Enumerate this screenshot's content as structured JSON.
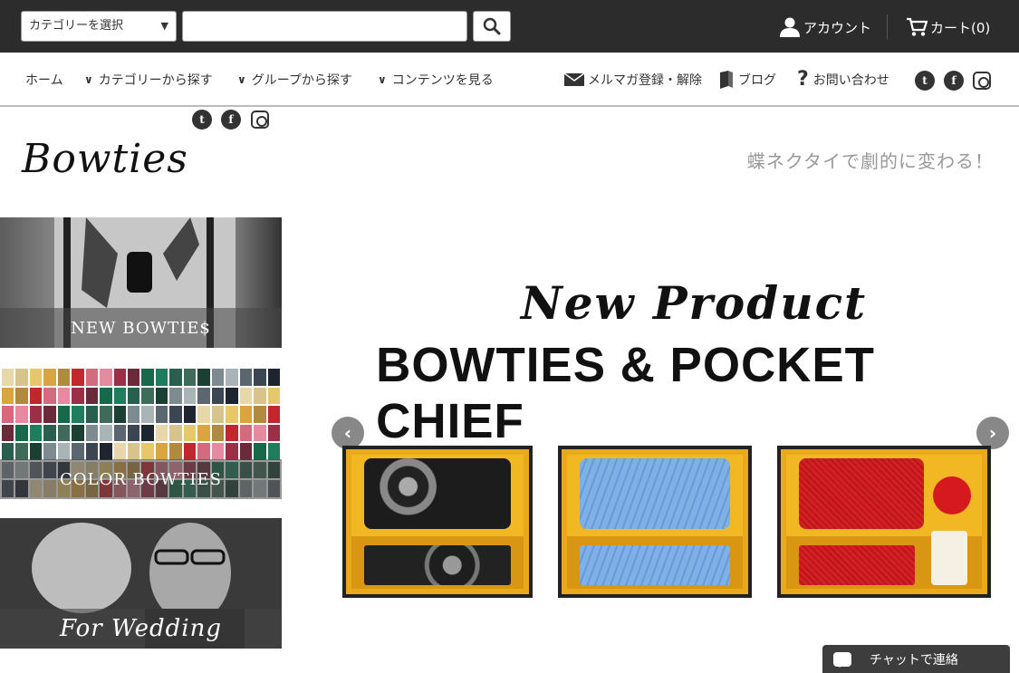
{
  "header": {
    "category_select": "カテゴリーを選択",
    "search_placeholder": "",
    "account_label": "アカウント",
    "cart_label": "カート(0)"
  },
  "nav": {
    "home": "ホーム",
    "category": "カテゴリーから探す",
    "group": "グループから探す",
    "contents": "コンテンツを見る",
    "newsletter": "メルマガ登録・解除",
    "blog": "ブログ",
    "contact": "お問い合わせ"
  },
  "brand": {
    "logo": "Bowties",
    "tagline": "蝶ネクタイで劇的に変わる！"
  },
  "sidebar": {
    "tiles": [
      {
        "label": "NEW BOWTIE$"
      },
      {
        "label": "COLOR BOWTIES"
      },
      {
        "label": "For Wedding"
      }
    ]
  },
  "banner": {
    "headline": "New Product",
    "subheadline": "BOWTIES & POCKET CHIEF",
    "prev": "‹",
    "next": "›"
  },
  "chat": {
    "label": "チャットで連絡"
  },
  "colors": {
    "topbar": "#2c2c2c",
    "swatches": [
      "#e8d7a8",
      "#d8c28e",
      "#e6c76a",
      "#d9a53e",
      "#b18a40",
      "#c1272d",
      "#d46a7e",
      "#e58aa0",
      "#9b2f45",
      "#6b2a3a",
      "#16694a",
      "#1e7d5c",
      "#2a5e4e",
      "#3e6b5a",
      "#1c3f34",
      "#7d8a8f",
      "#a9b4b6",
      "#5a6670",
      "#3b4652",
      "#1e2530"
    ]
  }
}
